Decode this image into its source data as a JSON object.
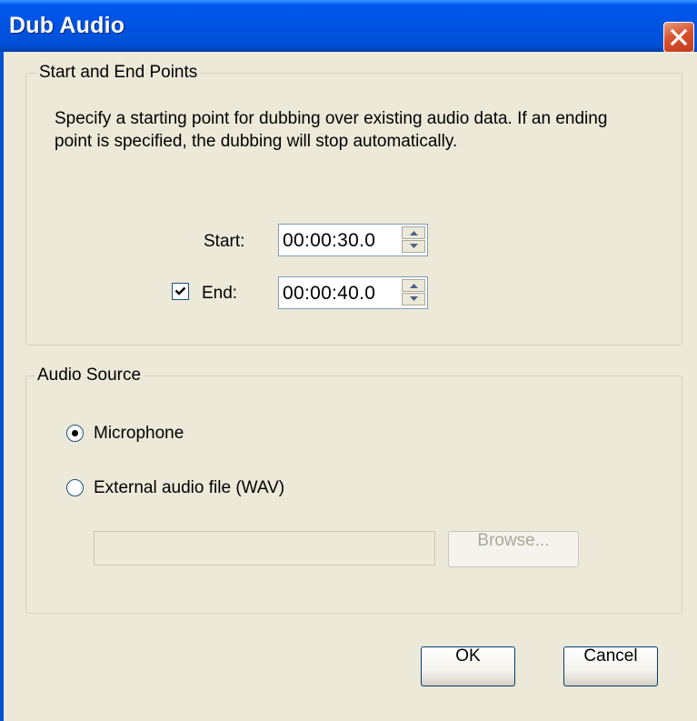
{
  "window": {
    "title": "Dub Audio"
  },
  "start_end_group": {
    "label": "Start and End Points",
    "description": "Specify a starting point for dubbing over existing audio data. If an ending point is specified, the dubbing will stop automatically.",
    "start_label": "Start:",
    "start_value": "00:00:30.0",
    "end_label": "End:",
    "end_value": "00:00:40.0",
    "end_checked": true
  },
  "audio_source_group": {
    "label": "Audio Source",
    "microphone_label": "Microphone",
    "external_label": "External audio file (WAV)",
    "selected": "Microphone",
    "file_path": "",
    "browse_label": "Browse..."
  },
  "buttons": {
    "ok_label": "OK",
    "cancel_label": "Cancel"
  },
  "icons": {
    "close": "close-icon",
    "spin_up": "arrow-up-icon",
    "spin_down": "arrow-down-icon",
    "check": "checkmark-icon"
  }
}
